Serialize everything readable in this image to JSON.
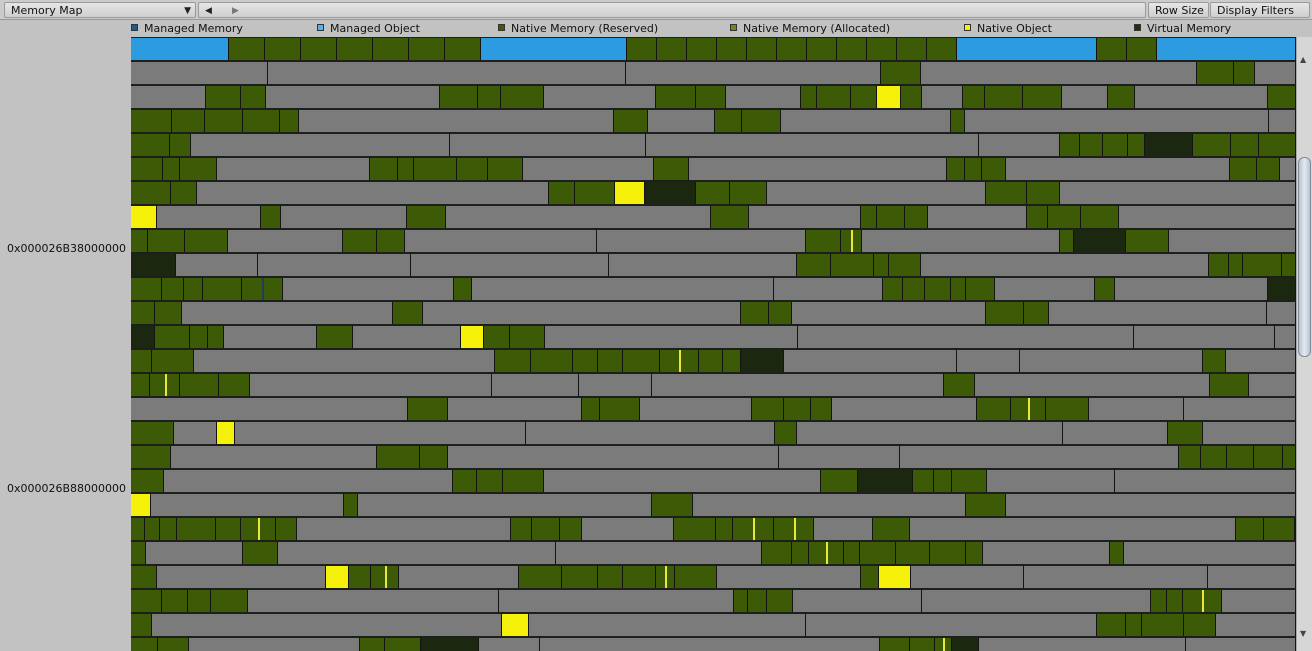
{
  "toolbar": {
    "view_select": "Memory Map",
    "row_size_label": "Row Size",
    "display_filters_label": "Display Filters"
  },
  "addresses": [
    "0x000026B38000000",
    "0x000026B88000000"
  ],
  "legend": [
    {
      "label": "Managed Memory",
      "color": "#1b5c8c"
    },
    {
      "label": "Managed Object",
      "color": "#52b0f0"
    },
    {
      "label": "Native Memory (Reserved)",
      "color": "#3d5a06"
    },
    {
      "label": "Native Memory (Allocated)",
      "color": "#6d8a1f"
    },
    {
      "label": "Native Object",
      "color": "#f6f10a"
    },
    {
      "label": "Virtual Memory",
      "color": "#223010"
    }
  ],
  "colors": {
    "gray": "#7b7b7b",
    "green": "#3d5a06",
    "blue": "#2d9be0",
    "yellow": "#f6f10a"
  }
}
